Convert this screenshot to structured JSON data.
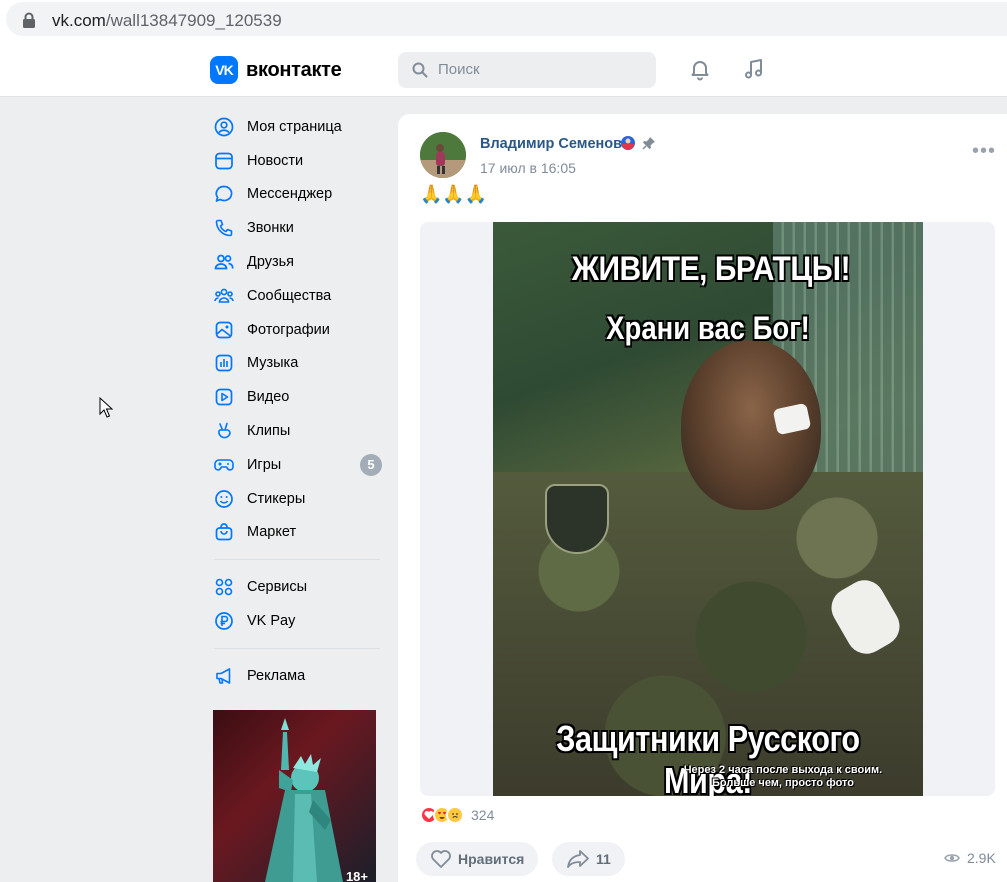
{
  "browser": {
    "url_host": "vk.com",
    "url_path": "/wall13847909_120539"
  },
  "header": {
    "logo_text": "вконтакте",
    "logo_mark": "VK",
    "search_placeholder": "Поиск"
  },
  "menu": {
    "items": [
      {
        "label": "Моя страница",
        "icon": "user-circle-icon"
      },
      {
        "label": "Новости",
        "icon": "news-icon"
      },
      {
        "label": "Мессенджер",
        "icon": "message-icon"
      },
      {
        "label": "Звонки",
        "icon": "phone-icon"
      },
      {
        "label": "Друзья",
        "icon": "friends-icon"
      },
      {
        "label": "Сообщества",
        "icon": "groups-icon"
      },
      {
        "label": "Фотографии",
        "icon": "photo-icon"
      },
      {
        "label": "Музыка",
        "icon": "music-icon"
      },
      {
        "label": "Видео",
        "icon": "video-icon"
      },
      {
        "label": "Клипы",
        "icon": "clips-icon"
      },
      {
        "label": "Игры",
        "icon": "gamepad-icon",
        "badge": "5"
      },
      {
        "label": "Стикеры",
        "icon": "smile-icon"
      },
      {
        "label": "Маркет",
        "icon": "bag-icon"
      }
    ],
    "extra": [
      {
        "label": "Сервисы",
        "icon": "services-icon"
      },
      {
        "label": "VK Pay",
        "icon": "ruble-icon"
      }
    ],
    "ads": {
      "label": "Реклама",
      "icon": "megaphone-icon"
    },
    "ad_age": "18+"
  },
  "post": {
    "author": "Владимир Семенов",
    "time": "17 июл в 16:05",
    "text": "🙏🙏🙏",
    "image": {
      "caption_top": "ЖИВИТЕ, БРАТЦЫ!",
      "caption_mid": "Храни вас Бог!",
      "caption_bottom": "Защитники Русского Мира!",
      "caption_small_1": "Через 2 часа после выхода к своим.",
      "caption_small_2": "Больше чем, просто фото"
    },
    "reactions_count": "324",
    "like_label": "Нравится",
    "share_count": "11",
    "views": "2.9K"
  },
  "colors": {
    "vk_blue": "#0077ff",
    "link": "#2a5885",
    "muted": "#818c99"
  }
}
